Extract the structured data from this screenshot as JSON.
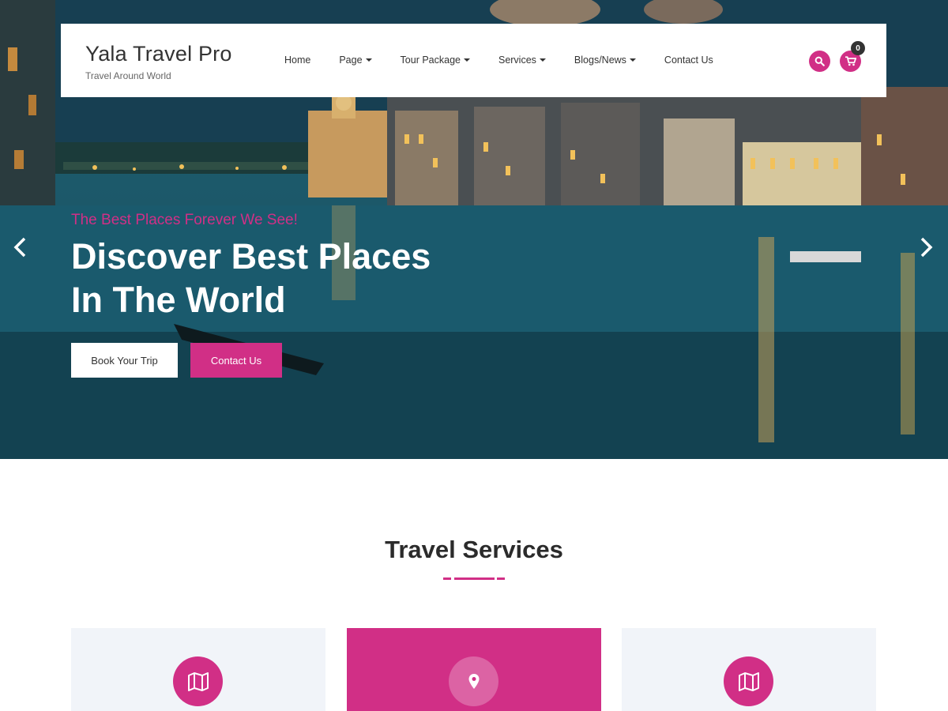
{
  "brand": {
    "title": "Yala Travel Pro",
    "tagline": "Travel Around World"
  },
  "nav": {
    "items": [
      {
        "label": "Home",
        "has_dropdown": false
      },
      {
        "label": "Page",
        "has_dropdown": true
      },
      {
        "label": "Tour Package",
        "has_dropdown": true
      },
      {
        "label": "Services",
        "has_dropdown": true
      },
      {
        "label": "Blogs/News",
        "has_dropdown": true
      },
      {
        "label": "Contact Us",
        "has_dropdown": false
      }
    ],
    "search_icon": "search-icon",
    "cart_icon": "cart-icon",
    "cart_count": "0"
  },
  "hero": {
    "subtitle": "The Best Places Forever We See!",
    "title_line1": "Discover Best Places",
    "title_line2": "In The World",
    "primary_button": "Book Your Trip",
    "secondary_button": "Contact Us",
    "prev_icon": "chevron-left-icon",
    "next_icon": "chevron-right-icon"
  },
  "services": {
    "title": "Travel Services",
    "cards": [
      {
        "icon": "map-icon",
        "active": false
      },
      {
        "icon": "map-pin-icon",
        "active": true
      },
      {
        "icon": "map-icon",
        "active": false
      }
    ]
  },
  "colors": {
    "accent": "#d12f86",
    "dark_text": "#333333",
    "card_bg": "#f1f4f9"
  }
}
